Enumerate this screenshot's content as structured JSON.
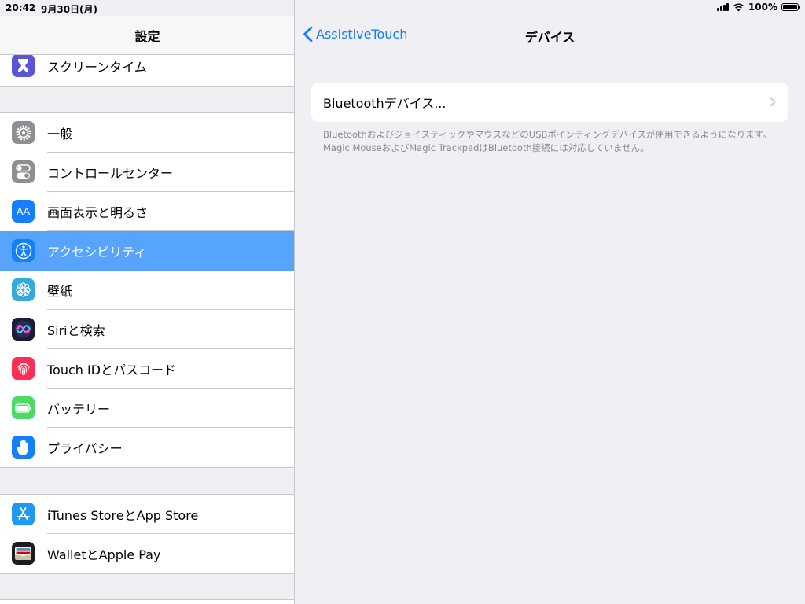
{
  "status_bar": {
    "time": "20:42",
    "date": "9月30日(月)",
    "battery": "100%",
    "battery_level": 1.0
  },
  "sidebar": {
    "title": "設定",
    "groups": [
      {
        "items": [
          {
            "label": "スクリーンタイム",
            "icon": "hourglass-icon",
            "color": "#5856d6"
          }
        ]
      },
      {
        "items": [
          {
            "label": "一般",
            "icon": "gear-icon",
            "color": "#8e8e93"
          },
          {
            "label": "コントロールセンター",
            "icon": "toggles-icon",
            "color": "#8e8e93"
          },
          {
            "label": "画面表示と明るさ",
            "icon": "text-size-icon",
            "icon_text": "AA",
            "color": "#157efb"
          },
          {
            "label": "アクセシビリティ",
            "icon": "accessibility-icon",
            "color": "#157efb",
            "selected": true
          },
          {
            "label": "壁紙",
            "icon": "flower-icon",
            "color": "#34aadc"
          },
          {
            "label": "Siriと検索",
            "icon": "siri-icon",
            "color": "#1c1c3a"
          },
          {
            "label": "Touch IDとパスコード",
            "icon": "fingerprint-icon",
            "color": "#ff2d55"
          },
          {
            "label": "バッテリー",
            "icon": "battery-icon",
            "color": "#4cd964"
          },
          {
            "label": "プライバシー",
            "icon": "hand-icon",
            "color": "#157efb"
          }
        ]
      },
      {
        "items": [
          {
            "label": "iTunes StoreとApp Store",
            "icon": "app-store-icon",
            "color": "#1e9bf0"
          },
          {
            "label": "WalletとApple Pay",
            "icon": "wallet-icon",
            "color": "#1c1c1e"
          }
        ]
      }
    ]
  },
  "detail": {
    "back_label": "AssistiveTouch",
    "title": "デバイス",
    "card_label": "Bluetoothデバイス...",
    "footnote": "BluetoothおよびジョイスティックやマウスなどのUSBポインティングデバイスが使用できるようになります。Magic MouseおよびMagic TrackpadはBluetooth接続には対応していません。"
  },
  "colors": {
    "accent": "#157efb",
    "selected_row": "#57a4ff",
    "background": "#efeff4",
    "separator": "#c8c7cc"
  }
}
